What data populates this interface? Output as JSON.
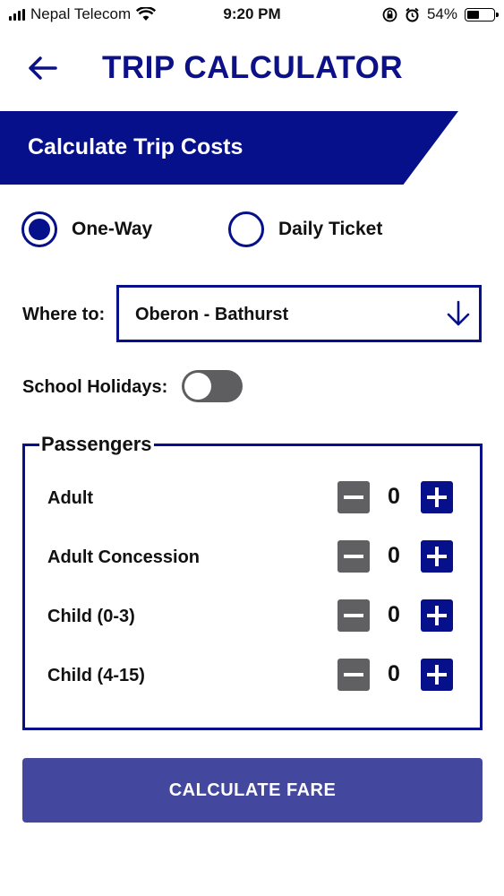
{
  "status_bar": {
    "carrier": "Nepal Telecom",
    "time": "9:20 PM",
    "battery_percent": "54%",
    "battery_level": 0.54,
    "icons": [
      "signal-bars-icon",
      "wifi-icon",
      "orientation-lock-icon",
      "alarm-icon",
      "battery-icon"
    ]
  },
  "header": {
    "back_icon": "back-arrow-icon",
    "title": "TRIP CALCULATOR"
  },
  "banner": {
    "title": "Calculate Trip Costs"
  },
  "trip_type": {
    "options": [
      {
        "label": "One-Way",
        "selected": true
      },
      {
        "label": "Daily Ticket",
        "selected": false
      }
    ]
  },
  "destination": {
    "label": "Where to:",
    "value": "Oberon - Bathurst",
    "icon": "arrow-down-icon"
  },
  "school_holidays": {
    "label": "School Holidays:",
    "enabled": false
  },
  "passengers": {
    "legend": "Passengers",
    "rows": [
      {
        "label": "Adult",
        "count": "0"
      },
      {
        "label": "Adult Concession",
        "count": "0"
      },
      {
        "label": "Child (0-3)",
        "count": "0"
      },
      {
        "label": "Child (4-15)",
        "count": "0"
      }
    ]
  },
  "actions": {
    "calculate_label": "CALCULATE FARE"
  },
  "colors": {
    "primary": "#05108a",
    "button": "#43479e",
    "minus_button": "#606062",
    "toggle_off": "#5e5e60"
  }
}
